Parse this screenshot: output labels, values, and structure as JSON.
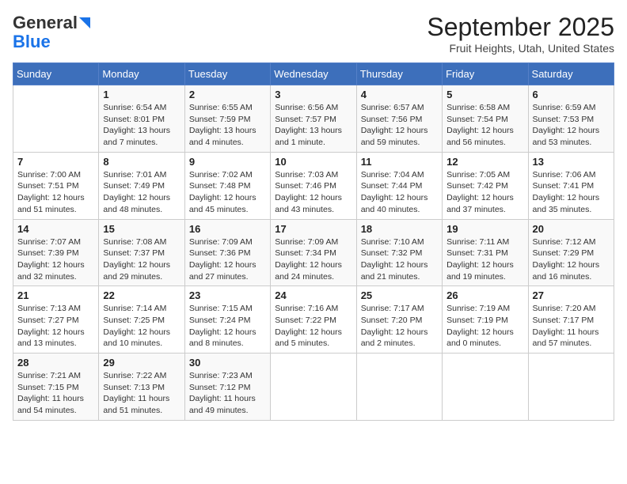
{
  "header": {
    "logo_line1": "General",
    "logo_line2": "Blue",
    "title": "September 2025",
    "subtitle": "Fruit Heights, Utah, United States"
  },
  "days_of_week": [
    "Sunday",
    "Monday",
    "Tuesday",
    "Wednesday",
    "Thursday",
    "Friday",
    "Saturday"
  ],
  "weeks": [
    [
      {
        "day": "",
        "sunrise": "",
        "sunset": "",
        "daylight": ""
      },
      {
        "day": "1",
        "sunrise": "Sunrise: 6:54 AM",
        "sunset": "Sunset: 8:01 PM",
        "daylight": "Daylight: 13 hours and 7 minutes."
      },
      {
        "day": "2",
        "sunrise": "Sunrise: 6:55 AM",
        "sunset": "Sunset: 7:59 PM",
        "daylight": "Daylight: 13 hours and 4 minutes."
      },
      {
        "day": "3",
        "sunrise": "Sunrise: 6:56 AM",
        "sunset": "Sunset: 7:57 PM",
        "daylight": "Daylight: 13 hours and 1 minute."
      },
      {
        "day": "4",
        "sunrise": "Sunrise: 6:57 AM",
        "sunset": "Sunset: 7:56 PM",
        "daylight": "Daylight: 12 hours and 59 minutes."
      },
      {
        "day": "5",
        "sunrise": "Sunrise: 6:58 AM",
        "sunset": "Sunset: 7:54 PM",
        "daylight": "Daylight: 12 hours and 56 minutes."
      },
      {
        "day": "6",
        "sunrise": "Sunrise: 6:59 AM",
        "sunset": "Sunset: 7:53 PM",
        "daylight": "Daylight: 12 hours and 53 minutes."
      }
    ],
    [
      {
        "day": "7",
        "sunrise": "Sunrise: 7:00 AM",
        "sunset": "Sunset: 7:51 PM",
        "daylight": "Daylight: 12 hours and 51 minutes."
      },
      {
        "day": "8",
        "sunrise": "Sunrise: 7:01 AM",
        "sunset": "Sunset: 7:49 PM",
        "daylight": "Daylight: 12 hours and 48 minutes."
      },
      {
        "day": "9",
        "sunrise": "Sunrise: 7:02 AM",
        "sunset": "Sunset: 7:48 PM",
        "daylight": "Daylight: 12 hours and 45 minutes."
      },
      {
        "day": "10",
        "sunrise": "Sunrise: 7:03 AM",
        "sunset": "Sunset: 7:46 PM",
        "daylight": "Daylight: 12 hours and 43 minutes."
      },
      {
        "day": "11",
        "sunrise": "Sunrise: 7:04 AM",
        "sunset": "Sunset: 7:44 PM",
        "daylight": "Daylight: 12 hours and 40 minutes."
      },
      {
        "day": "12",
        "sunrise": "Sunrise: 7:05 AM",
        "sunset": "Sunset: 7:42 PM",
        "daylight": "Daylight: 12 hours and 37 minutes."
      },
      {
        "day": "13",
        "sunrise": "Sunrise: 7:06 AM",
        "sunset": "Sunset: 7:41 PM",
        "daylight": "Daylight: 12 hours and 35 minutes."
      }
    ],
    [
      {
        "day": "14",
        "sunrise": "Sunrise: 7:07 AM",
        "sunset": "Sunset: 7:39 PM",
        "daylight": "Daylight: 12 hours and 32 minutes."
      },
      {
        "day": "15",
        "sunrise": "Sunrise: 7:08 AM",
        "sunset": "Sunset: 7:37 PM",
        "daylight": "Daylight: 12 hours and 29 minutes."
      },
      {
        "day": "16",
        "sunrise": "Sunrise: 7:09 AM",
        "sunset": "Sunset: 7:36 PM",
        "daylight": "Daylight: 12 hours and 27 minutes."
      },
      {
        "day": "17",
        "sunrise": "Sunrise: 7:09 AM",
        "sunset": "Sunset: 7:34 PM",
        "daylight": "Daylight: 12 hours and 24 minutes."
      },
      {
        "day": "18",
        "sunrise": "Sunrise: 7:10 AM",
        "sunset": "Sunset: 7:32 PM",
        "daylight": "Daylight: 12 hours and 21 minutes."
      },
      {
        "day": "19",
        "sunrise": "Sunrise: 7:11 AM",
        "sunset": "Sunset: 7:31 PM",
        "daylight": "Daylight: 12 hours and 19 minutes."
      },
      {
        "day": "20",
        "sunrise": "Sunrise: 7:12 AM",
        "sunset": "Sunset: 7:29 PM",
        "daylight": "Daylight: 12 hours and 16 minutes."
      }
    ],
    [
      {
        "day": "21",
        "sunrise": "Sunrise: 7:13 AM",
        "sunset": "Sunset: 7:27 PM",
        "daylight": "Daylight: 12 hours and 13 minutes."
      },
      {
        "day": "22",
        "sunrise": "Sunrise: 7:14 AM",
        "sunset": "Sunset: 7:25 PM",
        "daylight": "Daylight: 12 hours and 10 minutes."
      },
      {
        "day": "23",
        "sunrise": "Sunrise: 7:15 AM",
        "sunset": "Sunset: 7:24 PM",
        "daylight": "Daylight: 12 hours and 8 minutes."
      },
      {
        "day": "24",
        "sunrise": "Sunrise: 7:16 AM",
        "sunset": "Sunset: 7:22 PM",
        "daylight": "Daylight: 12 hours and 5 minutes."
      },
      {
        "day": "25",
        "sunrise": "Sunrise: 7:17 AM",
        "sunset": "Sunset: 7:20 PM",
        "daylight": "Daylight: 12 hours and 2 minutes."
      },
      {
        "day": "26",
        "sunrise": "Sunrise: 7:19 AM",
        "sunset": "Sunset: 7:19 PM",
        "daylight": "Daylight: 12 hours and 0 minutes."
      },
      {
        "day": "27",
        "sunrise": "Sunrise: 7:20 AM",
        "sunset": "Sunset: 7:17 PM",
        "daylight": "Daylight: 11 hours and 57 minutes."
      }
    ],
    [
      {
        "day": "28",
        "sunrise": "Sunrise: 7:21 AM",
        "sunset": "Sunset: 7:15 PM",
        "daylight": "Daylight: 11 hours and 54 minutes."
      },
      {
        "day": "29",
        "sunrise": "Sunrise: 7:22 AM",
        "sunset": "Sunset: 7:13 PM",
        "daylight": "Daylight: 11 hours and 51 minutes."
      },
      {
        "day": "30",
        "sunrise": "Sunrise: 7:23 AM",
        "sunset": "Sunset: 7:12 PM",
        "daylight": "Daylight: 11 hours and 49 minutes."
      },
      {
        "day": "",
        "sunrise": "",
        "sunset": "",
        "daylight": ""
      },
      {
        "day": "",
        "sunrise": "",
        "sunset": "",
        "daylight": ""
      },
      {
        "day": "",
        "sunrise": "",
        "sunset": "",
        "daylight": ""
      },
      {
        "day": "",
        "sunrise": "",
        "sunset": "",
        "daylight": ""
      }
    ]
  ]
}
